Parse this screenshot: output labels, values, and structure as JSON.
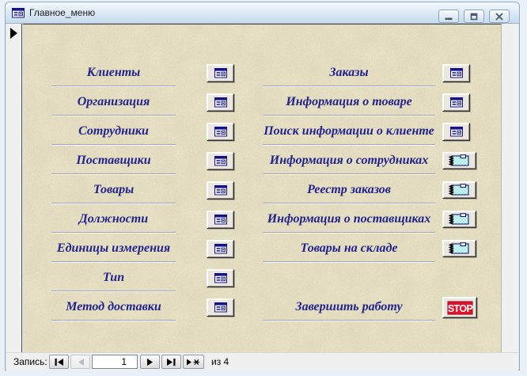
{
  "window": {
    "title": "Главное_меню",
    "titlebar_icon": "form-icon",
    "controls": [
      "minimize",
      "restore",
      "close"
    ]
  },
  "menu": {
    "left": [
      {
        "label": "Клиенты",
        "icon": "form-icon"
      },
      {
        "label": "Организация",
        "icon": "form-icon"
      },
      {
        "label": "Сотрудники",
        "icon": "form-icon"
      },
      {
        "label": "Поставщики",
        "icon": "form-icon"
      },
      {
        "label": "Товары",
        "icon": "form-icon"
      },
      {
        "label": "Должности",
        "icon": "form-icon"
      },
      {
        "label": "Единицы измерения",
        "icon": "form-icon"
      },
      {
        "label": "Тип",
        "icon": "form-icon"
      },
      {
        "label": "Метод доставки",
        "icon": "form-icon"
      }
    ],
    "right": [
      {
        "label": "Заказы",
        "icon": "form-icon"
      },
      {
        "label": "Информация о товаре",
        "icon": "form-icon"
      },
      {
        "label": "Поиск информации о клиенте",
        "icon": "form-icon"
      },
      {
        "label": "Информация о сотрудниках",
        "icon": "report-icon"
      },
      {
        "label": "Реестр заказов",
        "icon": "report-icon"
      },
      {
        "label": "Информация о поставщиках",
        "icon": "report-icon"
      },
      {
        "label": "Товары на складе",
        "icon": "report-icon"
      },
      {
        "label": "Завершить работу",
        "icon": "stop-icon"
      }
    ],
    "stop_label": "STOP"
  },
  "record_nav": {
    "label": "Запись:",
    "current": "1",
    "total": "из 4",
    "buttons": [
      "first-record",
      "previous-record",
      "next-record",
      "last-record",
      "new-record"
    ]
  },
  "colors": {
    "label_text": "#22228e",
    "form_background": "#ece6cb",
    "titlebar_top": "#f4f9fd",
    "titlebar_bottom": "#c7dcee",
    "stop_red": "#e8112d",
    "report_cyan": "#7df2f2",
    "icon_navy": "#141487"
  }
}
